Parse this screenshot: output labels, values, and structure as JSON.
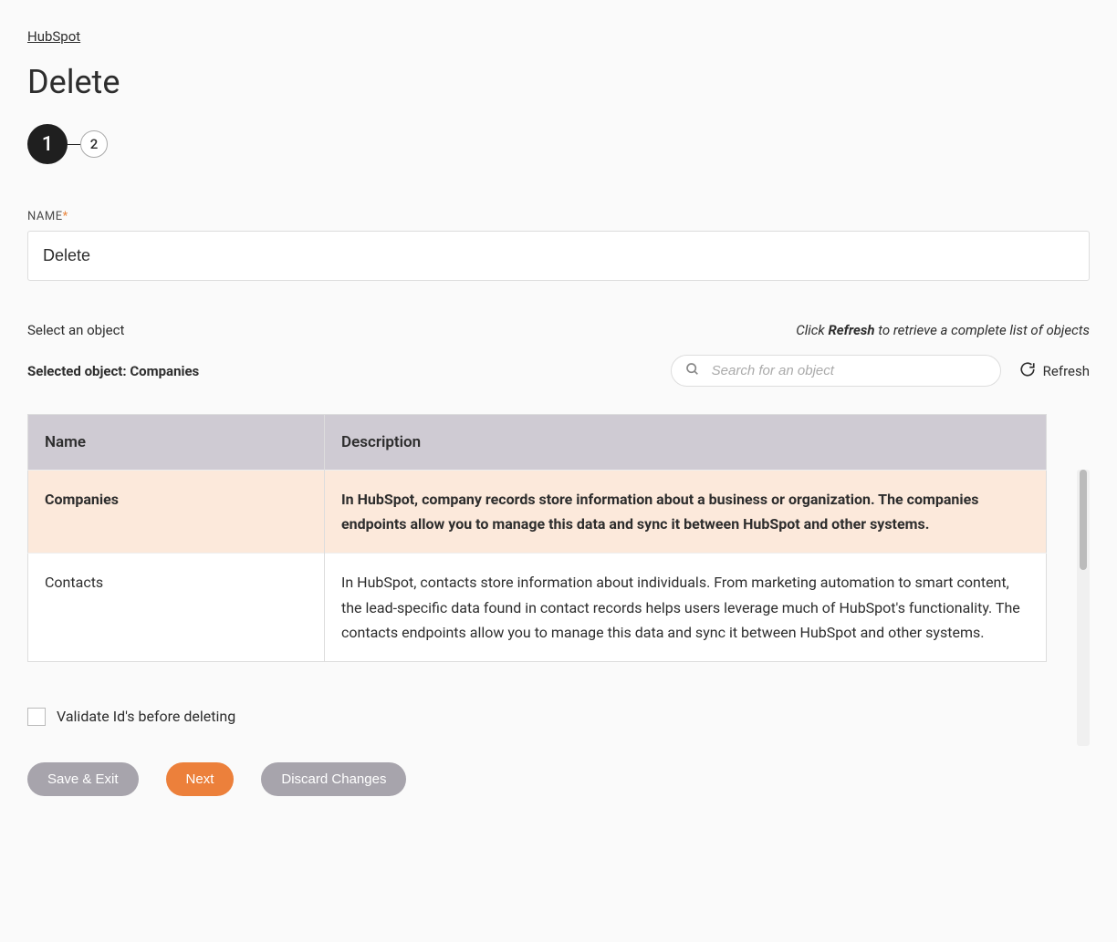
{
  "breadcrumb": "HubSpot",
  "page_title": "Delete",
  "stepper": {
    "current": "1",
    "next": "2"
  },
  "form": {
    "name_label": "NAME",
    "name_value": "Delete"
  },
  "object_section": {
    "select_label": "Select an object",
    "refresh_hint_prefix": "Click ",
    "refresh_hint_bold": "Refresh",
    "refresh_hint_suffix": " to retrieve a complete list of objects",
    "selected_label": "Selected object: Companies",
    "search_placeholder": "Search for an object",
    "refresh_button": "Refresh"
  },
  "table": {
    "headers": {
      "name": "Name",
      "description": "Description"
    },
    "rows": [
      {
        "name": "Companies",
        "description": "In HubSpot, company records store information about a business or organization. The companies endpoints allow you to manage this data and sync it between HubSpot and other systems.",
        "selected": true
      },
      {
        "name": "Contacts",
        "description": "In HubSpot, contacts store information about individuals. From marketing automation to smart content, the lead-specific data found in contact records helps users leverage much of HubSpot's functionality. The contacts endpoints allow you to manage this data and sync it between HubSpot and other systems.",
        "selected": false
      }
    ]
  },
  "validate_checkbox": {
    "label": "Validate Id's before deleting",
    "checked": false
  },
  "buttons": {
    "save_exit": "Save & Exit",
    "next": "Next",
    "discard": "Discard Changes"
  }
}
